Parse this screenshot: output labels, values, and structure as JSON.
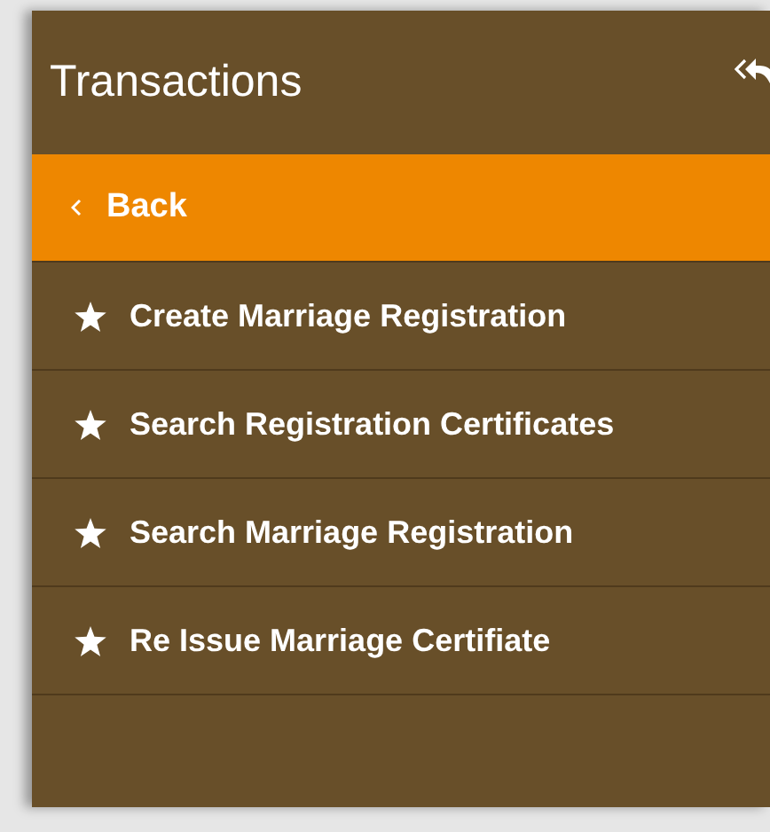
{
  "sidebar": {
    "title": "Transactions",
    "items": [
      {
        "kind": "back",
        "label": "Back"
      },
      {
        "kind": "link",
        "label": "Create Marriage Registration"
      },
      {
        "kind": "link",
        "label": "Search Registration Certificates"
      },
      {
        "kind": "link",
        "label": "Search Marriage Registration"
      },
      {
        "kind": "link",
        "label": "Re Issue Marriage Certifiate"
      }
    ]
  }
}
